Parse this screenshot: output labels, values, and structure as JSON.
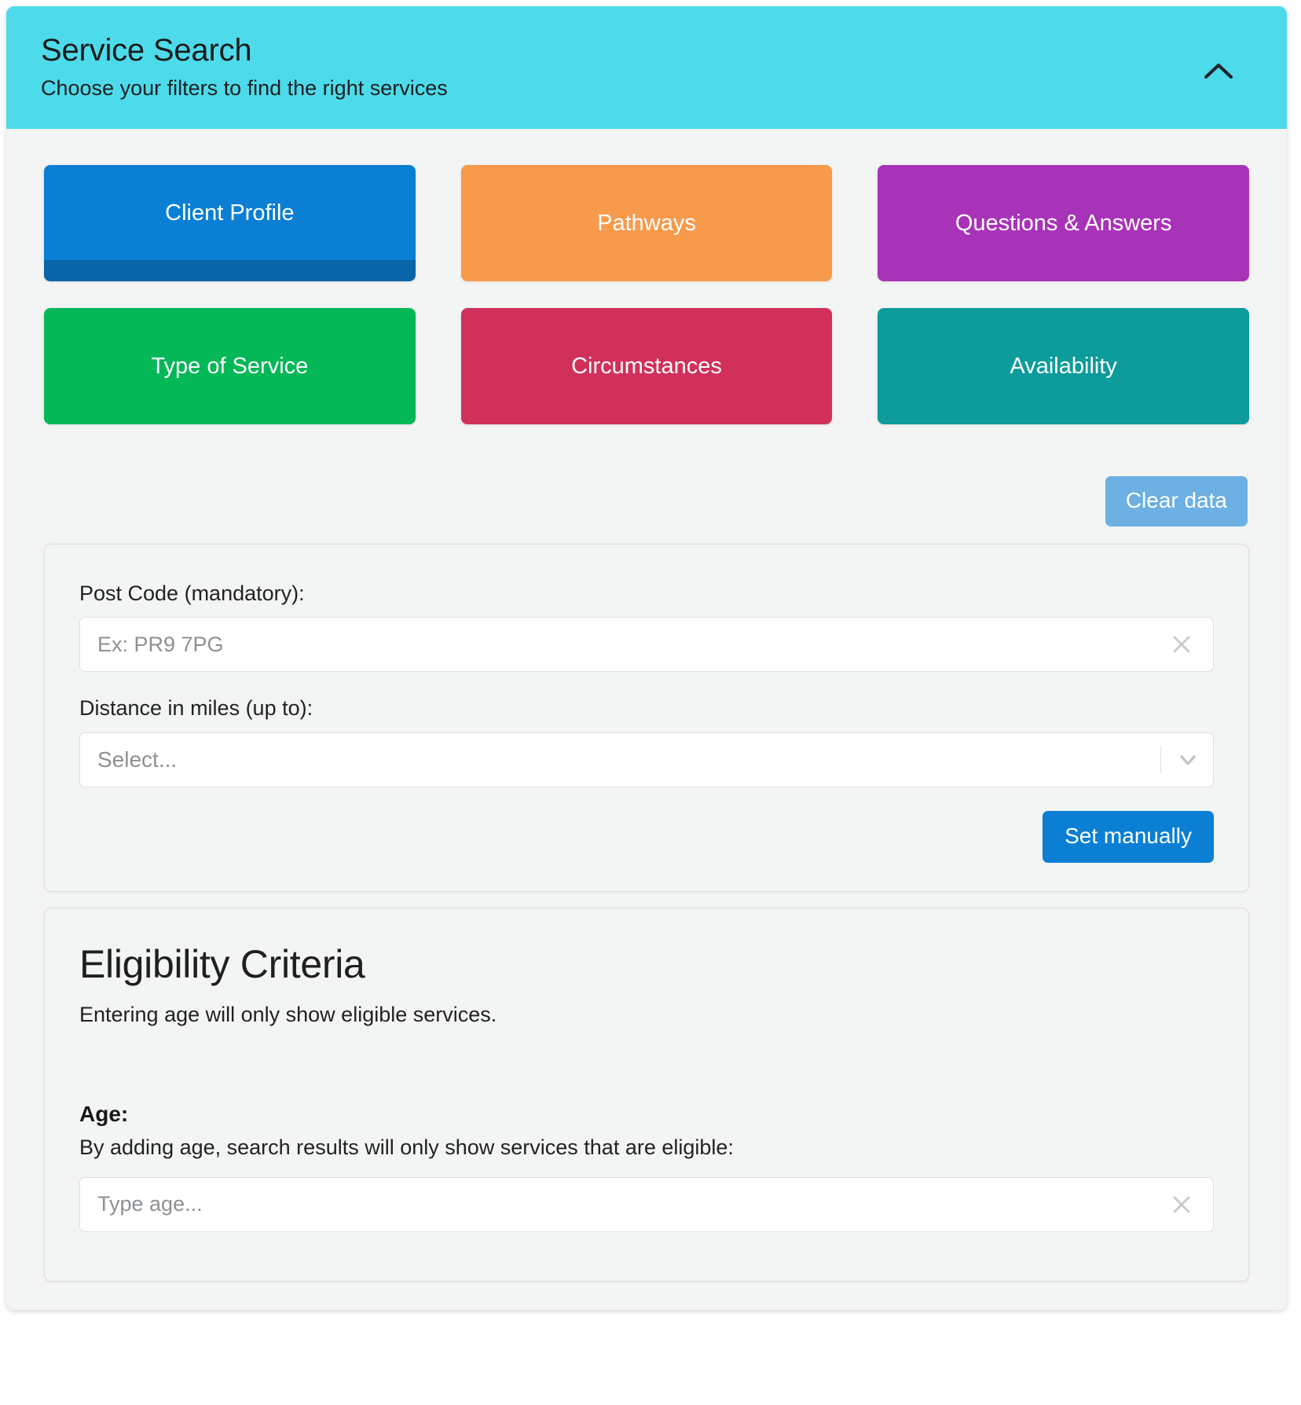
{
  "header": {
    "title": "Service Search",
    "subtitle": "Choose your filters to find the right services",
    "collapse_icon": "chevron-up-icon",
    "background_color": "#4DDBEB"
  },
  "filters": [
    {
      "label": "Client Profile",
      "color": "#0A7FD4",
      "has_progress": true,
      "icon": ""
    },
    {
      "label": "Pathways",
      "color": "#F89A4B",
      "has_progress": false,
      "icon": ""
    },
    {
      "label": "Questions & Answers",
      "color": "#A933B8",
      "has_progress": false,
      "icon": ""
    },
    {
      "label": "Type of Service",
      "color": "#04B857",
      "has_progress": false,
      "icon": ""
    },
    {
      "label": "Circumstances",
      "color": "#D1305B",
      "has_progress": false,
      "icon": ""
    },
    {
      "label": "Availability",
      "color": "#0D9B9B",
      "has_progress": false,
      "icon": ""
    }
  ],
  "actions": {
    "clear_data_label": "Clear data",
    "clear_data_color": "#6CB0E4",
    "set_manually_label": "Set manually",
    "set_manually_color": "#0A7FD4"
  },
  "location": {
    "postcode_label": "Post Code (mandatory):",
    "postcode_value": "",
    "postcode_placeholder": "Ex: PR9 7PG",
    "postcode_clear_icon": "close-icon",
    "distance_label": "Distance in miles (up to):",
    "distance_value": "Select...",
    "distance_arrow_icon": "chevron-down-icon"
  },
  "eligibility": {
    "title": "Eligibility Criteria",
    "subtitle": "Entering age will only show eligible services.",
    "age_label": "Age:",
    "age_help": "By adding age, search results will only show services that are eligible:",
    "age_value": "",
    "age_placeholder": "Type age...",
    "age_clear_icon": "close-icon"
  }
}
